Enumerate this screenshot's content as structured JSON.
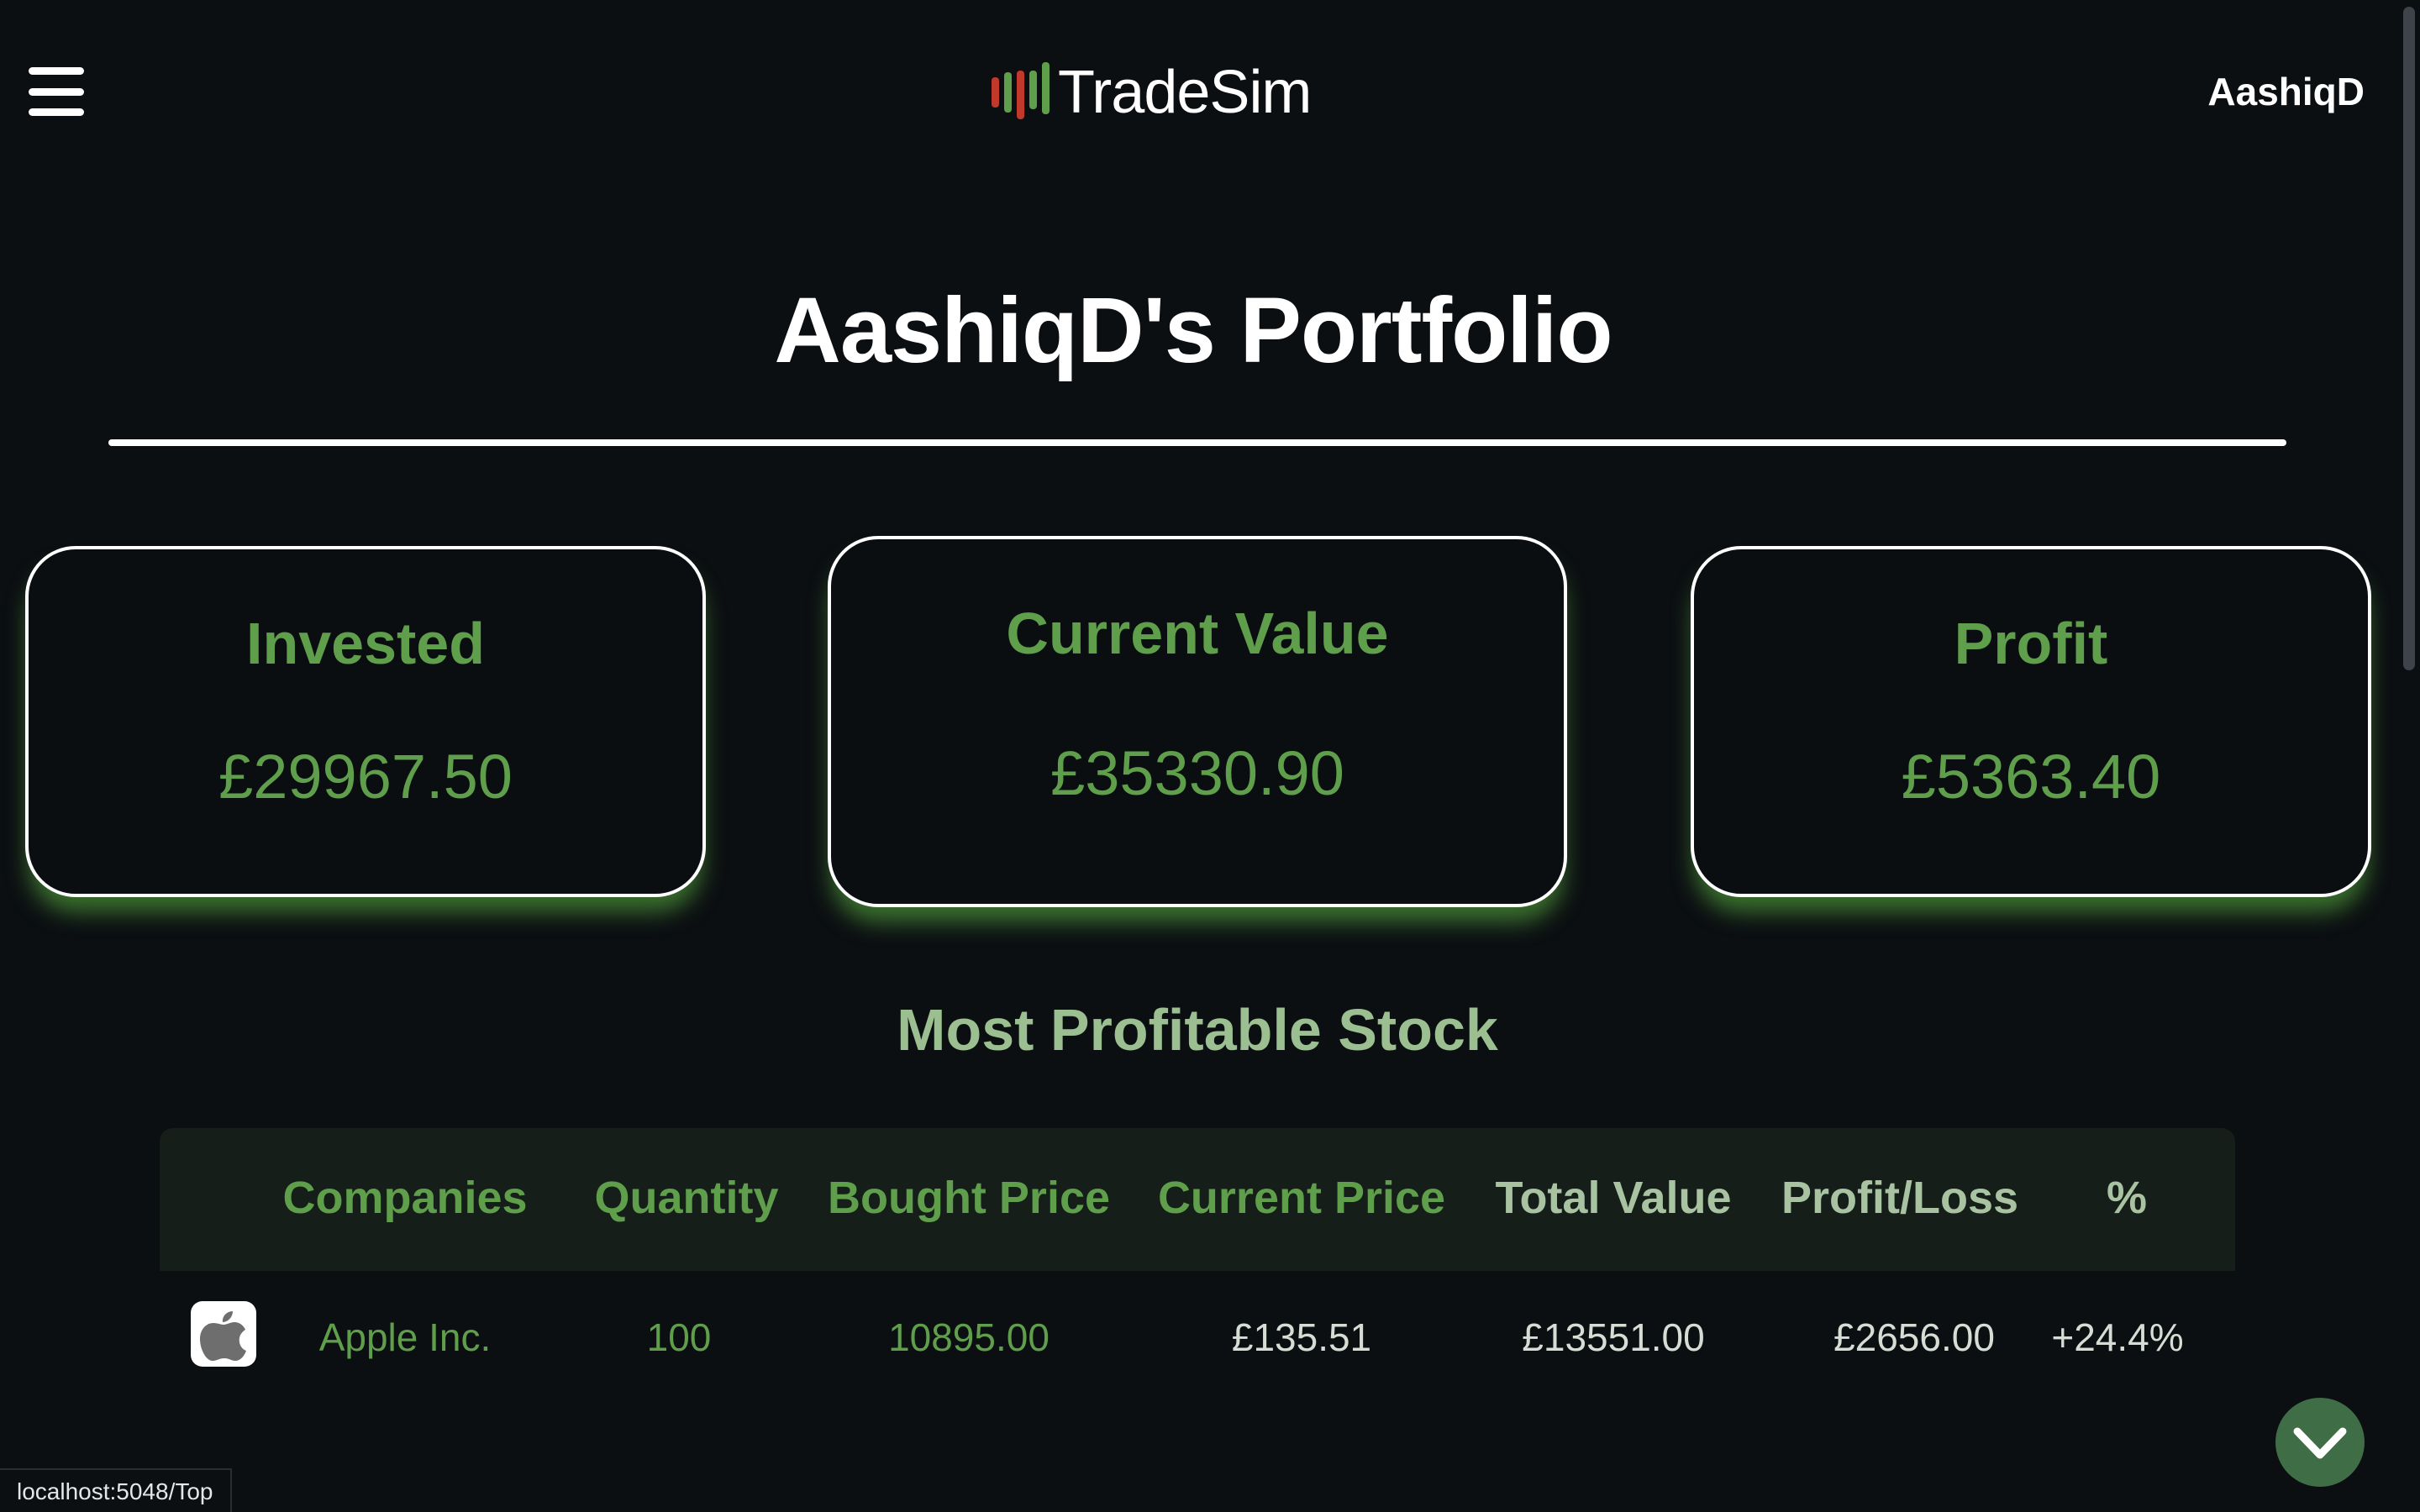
{
  "header": {
    "logo_text": "TradeSim",
    "username": "AashiqD"
  },
  "page": {
    "title": "AashiqD's Portfolio"
  },
  "summary": {
    "invested_label": "Invested",
    "invested_value": "£29967.50",
    "current_label": "Current Value",
    "current_value": "£35330.90",
    "profit_label": "Profit",
    "profit_value": "£5363.40"
  },
  "section": {
    "title": "Most Profitable Stock"
  },
  "table": {
    "headers": [
      "Companies",
      "Quantity",
      "Bought Price",
      "Current Price",
      "Total Value",
      "Profit/Loss",
      "%"
    ],
    "rows": [
      {
        "logo_icon": "apple-icon",
        "company": "Apple Inc.",
        "quantity": "100",
        "bought_price": "10895.00",
        "current_price": "£135.51",
        "total_value": "£13551.00",
        "profit_loss": "£2656.00",
        "percent": "+24.4%"
      }
    ]
  },
  "status_bar": {
    "url": "localhost:5048/Top"
  },
  "colors": {
    "background": "#0c0f12",
    "accent_green": "#5f9e4a",
    "table_header_bg": "#151e19",
    "scroll_button": "#3f6d45",
    "logo_red": "#c0392b",
    "logo_green": "#5f9e4a"
  },
  "icons": {
    "menu": "hamburger-menu-icon",
    "logo": "candlestick-chart-icon",
    "scroll": "chevron-down-icon"
  }
}
